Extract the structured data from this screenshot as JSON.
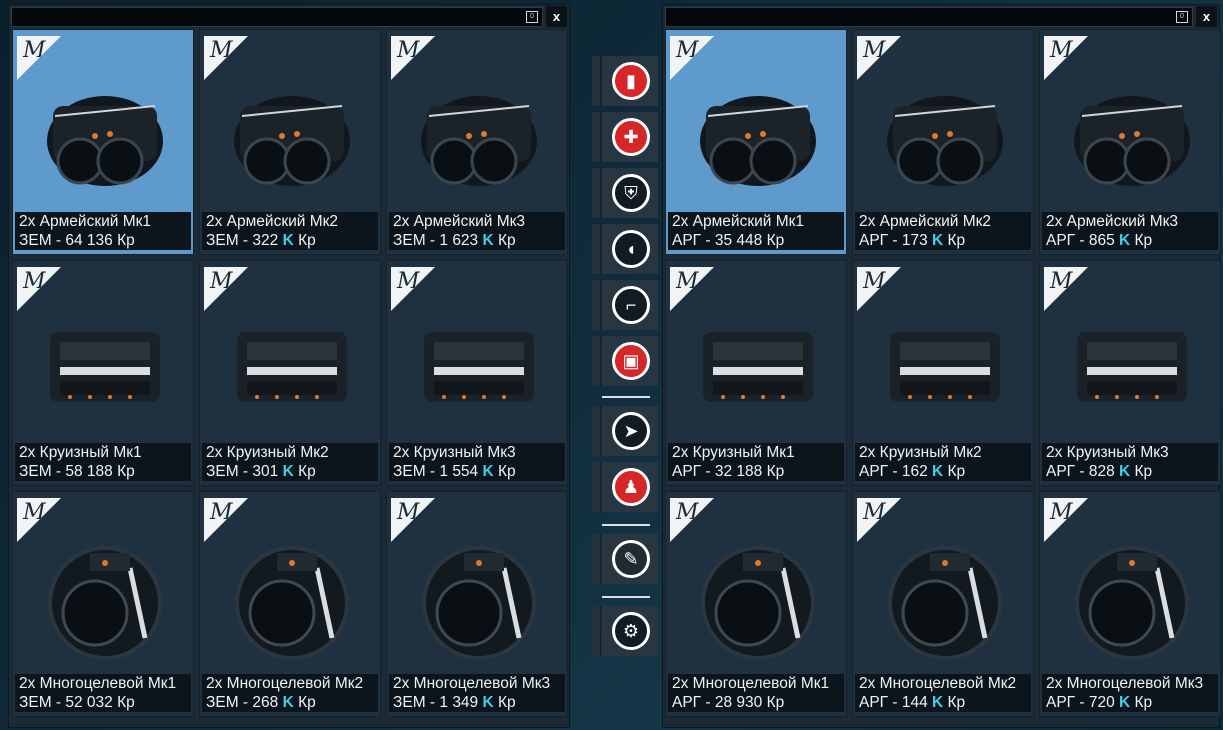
{
  "left_panel": {
    "close_label": "x",
    "mini_label": "0",
    "badge_letter": "M",
    "items": [
      {
        "name": "2x Армейский Мк1",
        "prefix": "ЗЕМ - 64 136",
        "kmark": "",
        "suffix": " Кр",
        "selected": true
      },
      {
        "name": "2x Армейский Мк2",
        "prefix": "ЗЕМ - 322 ",
        "kmark": "K",
        "suffix": " Кр",
        "selected": false
      },
      {
        "name": "2x Армейский Мк3",
        "prefix": "ЗЕМ - 1 623 ",
        "kmark": "K",
        "suffix": " Кр",
        "selected": false
      },
      {
        "name": "2x Круизный Мк1",
        "prefix": "ЗЕМ - 58 188",
        "kmark": "",
        "suffix": " Кр",
        "selected": false
      },
      {
        "name": "2x Круизный Мк2",
        "prefix": "ЗЕМ - 301 ",
        "kmark": "K",
        "suffix": " Кр",
        "selected": false
      },
      {
        "name": "2x Круизный Мк3",
        "prefix": "ЗЕМ - 1 554 ",
        "kmark": "K",
        "suffix": " Кр",
        "selected": false
      },
      {
        "name": "2x Многоцелевой Мк1",
        "prefix": "ЗЕМ - 52 032",
        "kmark": "",
        "suffix": " Кр",
        "selected": false
      },
      {
        "name": "2x Многоцелевой Мк2",
        "prefix": "ЗЕМ - 268 ",
        "kmark": "K",
        "suffix": " Кр",
        "selected": false
      },
      {
        "name": "2x Многоцелевой Мк3",
        "prefix": "ЗЕМ - 1 349 ",
        "kmark": "K",
        "suffix": " Кр",
        "selected": false
      }
    ]
  },
  "right_panel": {
    "close_label": "x",
    "mini_label": "0",
    "badge_letter": "M",
    "items": [
      {
        "name": "2x Армейский Мк1",
        "prefix": "АРГ - 35 448",
        "kmark": "",
        "suffix": " Кр",
        "selected": true
      },
      {
        "name": "2x Армейский Мк2",
        "prefix": "АРГ - 173 ",
        "kmark": "K",
        "suffix": " Кр",
        "selected": false
      },
      {
        "name": "2x Армейский Мк3",
        "prefix": "АРГ - 865 ",
        "kmark": "K",
        "suffix": " Кр",
        "selected": false
      },
      {
        "name": "2x Круизный Мк1",
        "prefix": "АРГ - 32 188",
        "kmark": "",
        "suffix": " Кр",
        "selected": false
      },
      {
        "name": "2x Круизный Мк2",
        "prefix": "АРГ - 162 ",
        "kmark": "K",
        "suffix": " Кр",
        "selected": false
      },
      {
        "name": "2x Круизный Мк3",
        "prefix": "АРГ - 828 ",
        "kmark": "K",
        "suffix": " Кр",
        "selected": false
      },
      {
        "name": "2x Многоцелевой Мк1",
        "prefix": "АРГ - 28 930",
        "kmark": "",
        "suffix": " Кр",
        "selected": false
      },
      {
        "name": "2x Многоцелевой Мк2",
        "prefix": "АРГ - 144 ",
        "kmark": "K",
        "suffix": " Кр",
        "selected": false
      },
      {
        "name": "2x Многоцелевой Мк3",
        "prefix": "АРГ - 720 ",
        "kmark": "K",
        "suffix": " Кр",
        "selected": false
      }
    ]
  },
  "sidebar": {
    "buttons": [
      {
        "icon": "ship-fuel-icon",
        "style": "red"
      },
      {
        "icon": "weapons-cross-icon",
        "style": "red"
      },
      {
        "icon": "shield-icon",
        "style": "white"
      },
      {
        "icon": "engine-thruster-icon",
        "style": "white"
      },
      {
        "icon": "turret-icon",
        "style": "white"
      },
      {
        "icon": "reactor-icon",
        "style": "red"
      },
      {
        "icon": "missile-icon",
        "style": "white"
      },
      {
        "icon": "crew-icon",
        "style": "red"
      },
      {
        "icon": "wrench-icon",
        "style": "dark"
      },
      {
        "icon": "gear-icon",
        "style": "white"
      }
    ]
  },
  "colors": {
    "selected": "#5e9bcc",
    "accent_k": "#3fd0e6",
    "caption_bg": "#0c151c"
  }
}
